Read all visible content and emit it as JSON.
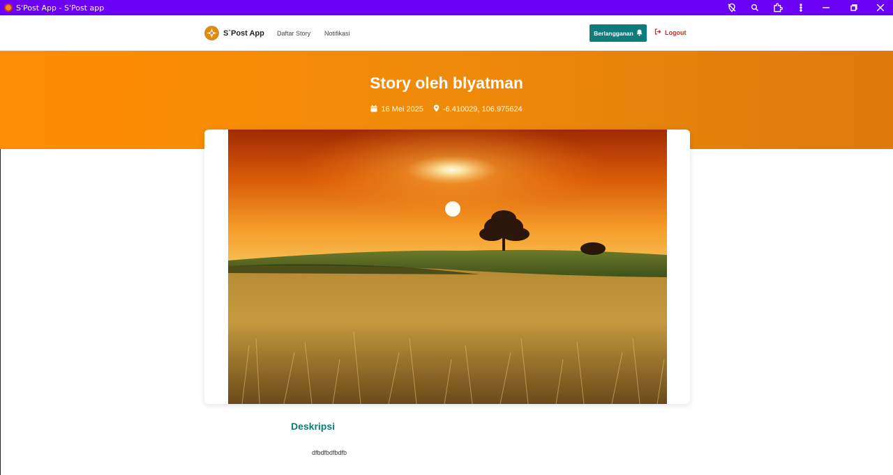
{
  "window": {
    "title": "S'Post App - S'Post app",
    "icons": [
      "location-off-icon",
      "zoom-icon",
      "extension-icon",
      "more-icon",
      "minimize-icon",
      "restore-icon",
      "close-icon"
    ]
  },
  "nav": {
    "brand": "S`Post App",
    "links": [
      "Daftar Story",
      "Notifikasi"
    ],
    "subscribe_label": "Berlangganan",
    "logout_label": "Logout"
  },
  "hero": {
    "title": "Story oleh blyatman",
    "date": "16 Mei 2025",
    "location": "-6.410029, 106.975624"
  },
  "story": {
    "description_heading": "Deskripsi",
    "description": "dfbdfbdfbdfb"
  },
  "colors": {
    "title_bar": "#6a00f4",
    "hero": "#f08a0a",
    "accent": "#0e7c7b",
    "logout": "#d8261f"
  }
}
